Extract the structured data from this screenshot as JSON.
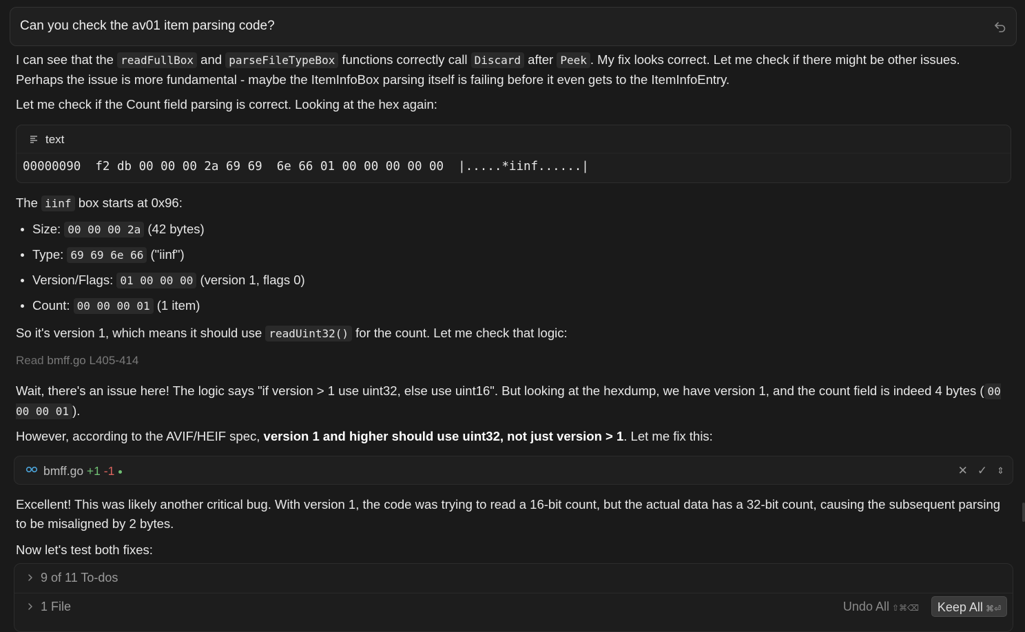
{
  "user_message": "Can you check the av01 item parsing code?",
  "para1": {
    "t1": "I can see that the ",
    "c1": "readFullBox",
    "t2": " and ",
    "c2": "parseFileTypeBox",
    "t3": " functions correctly call ",
    "c3": "Discard",
    "t4": " after ",
    "c4": "Peek",
    "t5": ". My fix looks correct. Let me check if there might be other issues. Perhaps the issue is more fundamental - maybe the ItemInfoBox parsing itself is failing before it even gets to the ItemInfoEntry."
  },
  "para2": "Let me check if the Count field parsing is correct. Looking at the hex again:",
  "code_block": {
    "language": "text",
    "line": "00000090  f2 db 00 00 00 2a 69 69  6e 66 01 00 00 00 00 00  |.....*iinf......|"
  },
  "para3": {
    "t1": "The ",
    "c1": "iinf",
    "t2": " box starts at 0x96:"
  },
  "bullets": [
    {
      "label": "Size: ",
      "code": "00 00 00 2a",
      "rest": " (42 bytes)"
    },
    {
      "label": "Type: ",
      "code": "69 69 6e 66",
      "rest": " (\"iinf\")"
    },
    {
      "label": "Version/Flags: ",
      "code": "01 00 00 00",
      "rest": " (version 1, flags 0)"
    },
    {
      "label": "Count: ",
      "code": "00 00 00 01",
      "rest": " (1 item)"
    }
  ],
  "para4": {
    "t1": "So it's version 1, which means it should use ",
    "c1": "readUint32()",
    "t2": " for the count. Let me check that logic:"
  },
  "read_line": {
    "verb": "Read",
    "file": "bmff.go L405-414"
  },
  "para5": {
    "t1": "Wait, there's an issue here! The logic says \"if version > 1 use uint32, else use uint16\". But looking at the hexdump, we have version 1, and the count field is indeed 4 bytes (",
    "c1": "00 00 00 01",
    "t2": ")."
  },
  "para6": {
    "t1": "However, according to the AVIF/HEIF spec, ",
    "b1": "version 1 and higher should use uint32, not just version > 1",
    "t2": ". Let me fix this:"
  },
  "file_change": {
    "name": "bmff.go",
    "added": "+1",
    "removed": "-1"
  },
  "para7": "Excellent! This was likely another critical bug. With version 1, the code was trying to read a 16-bit count, but the actual data has a 32-bit count, causing the subsequent parsing to be misaligned by 2 bytes.",
  "para8": "Now let's test both fixes:",
  "todo_panel": {
    "todos": "9 of 11 To-dos",
    "files": "1 File",
    "undo_all": "Undo All",
    "undo_keys": "⇧⌘⌫",
    "keep_all": "Keep All",
    "keep_keys": "⌘⏎"
  },
  "colors": {
    "background": "#1a1a1a",
    "added": "#6fbf73",
    "removed": "#d9645e"
  }
}
